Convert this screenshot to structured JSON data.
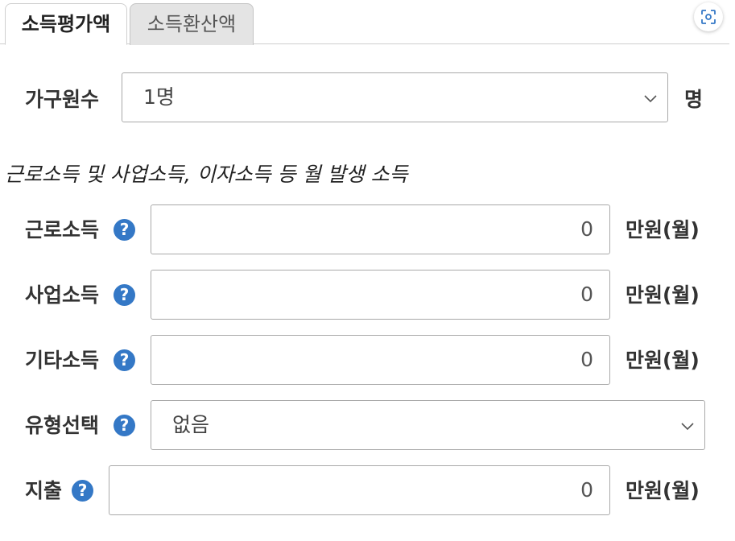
{
  "tabs": [
    {
      "label": "소득평가액",
      "active": true
    },
    {
      "label": "소득환산액",
      "active": false
    }
  ],
  "household": {
    "label": "가구원수",
    "value": "1명",
    "unit": "명"
  },
  "section_note": "근로소득 및 사업소득, 이자소득 등 월 발생 소득",
  "help_glyph": "?",
  "rows": {
    "earned": {
      "label": "근로소득",
      "value": "0",
      "unit": "만원(월)"
    },
    "business": {
      "label": "사업소득",
      "value": "0",
      "unit": "만원(월)"
    },
    "other": {
      "label": "기타소득",
      "value": "0",
      "unit": "만원(월)"
    },
    "type": {
      "label": "유형선택",
      "value": "없음"
    },
    "expense": {
      "label": "지출",
      "value": "0",
      "unit": "만원(월)"
    }
  },
  "icons": {
    "help": "question-circle-icon",
    "chevron": "chevron-down-icon",
    "scan": "scan-icon"
  },
  "colors": {
    "help_icon": "#3478c6",
    "tab_inactive_bg": "#e4e4e4",
    "field_border": "#a9a9a9"
  }
}
